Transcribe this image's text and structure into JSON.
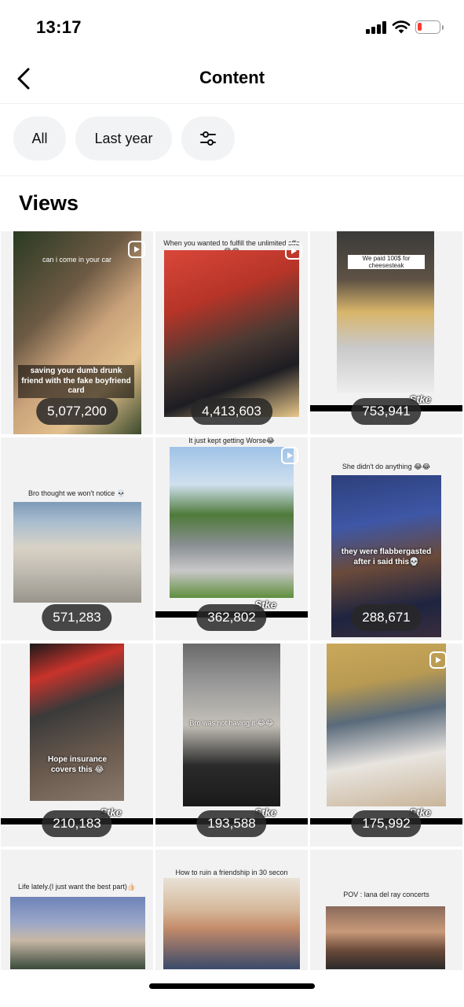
{
  "status_bar": {
    "time": "13:17"
  },
  "header": {
    "title": "Content",
    "back_icon": "chevron-left-icon"
  },
  "filters": {
    "all_label": "All",
    "period_label": "Last year",
    "filter_icon": "sliders-icon"
  },
  "section": {
    "title": "Views"
  },
  "tiles": [
    {
      "views": "5,077,200",
      "caption_top": "can i come in your car",
      "caption_overlay": "saving your dumb drunk friend with the fake boyfriend card"
    },
    {
      "views": "4,413,603",
      "caption_top": "When you wanted to fulfill the unlimited offe 😂😂"
    },
    {
      "views": "753,941",
      "caption_top": "We paid 100$ for cheesesteak",
      "watermark": "Stke"
    },
    {
      "views": "571,283",
      "caption_top": "Bro thought we won't notice 💀"
    },
    {
      "views": "362,802",
      "caption_top": "It just kept getting Worse😂",
      "watermark": "Stke"
    },
    {
      "views": "288,671",
      "caption_top": "She didn't do anything 😂😂",
      "caption_overlay": "they were flabbergasted after i said this💀"
    },
    {
      "views": "210,183",
      "caption_overlay": "Hope insurance covers this 😂",
      "watermark": "Stke"
    },
    {
      "views": "193,588",
      "caption_top": "Bro was not having it 😂😂",
      "watermark": "Stke"
    },
    {
      "views": "175,992",
      "watermark": "Stke"
    },
    {
      "caption_top": "Life lately.(I just want the best part)👍🏻"
    },
    {
      "caption_top": "How to ruin a friendship in 30 secon"
    },
    {
      "caption_top": "POV : lana del ray concerts"
    }
  ]
}
